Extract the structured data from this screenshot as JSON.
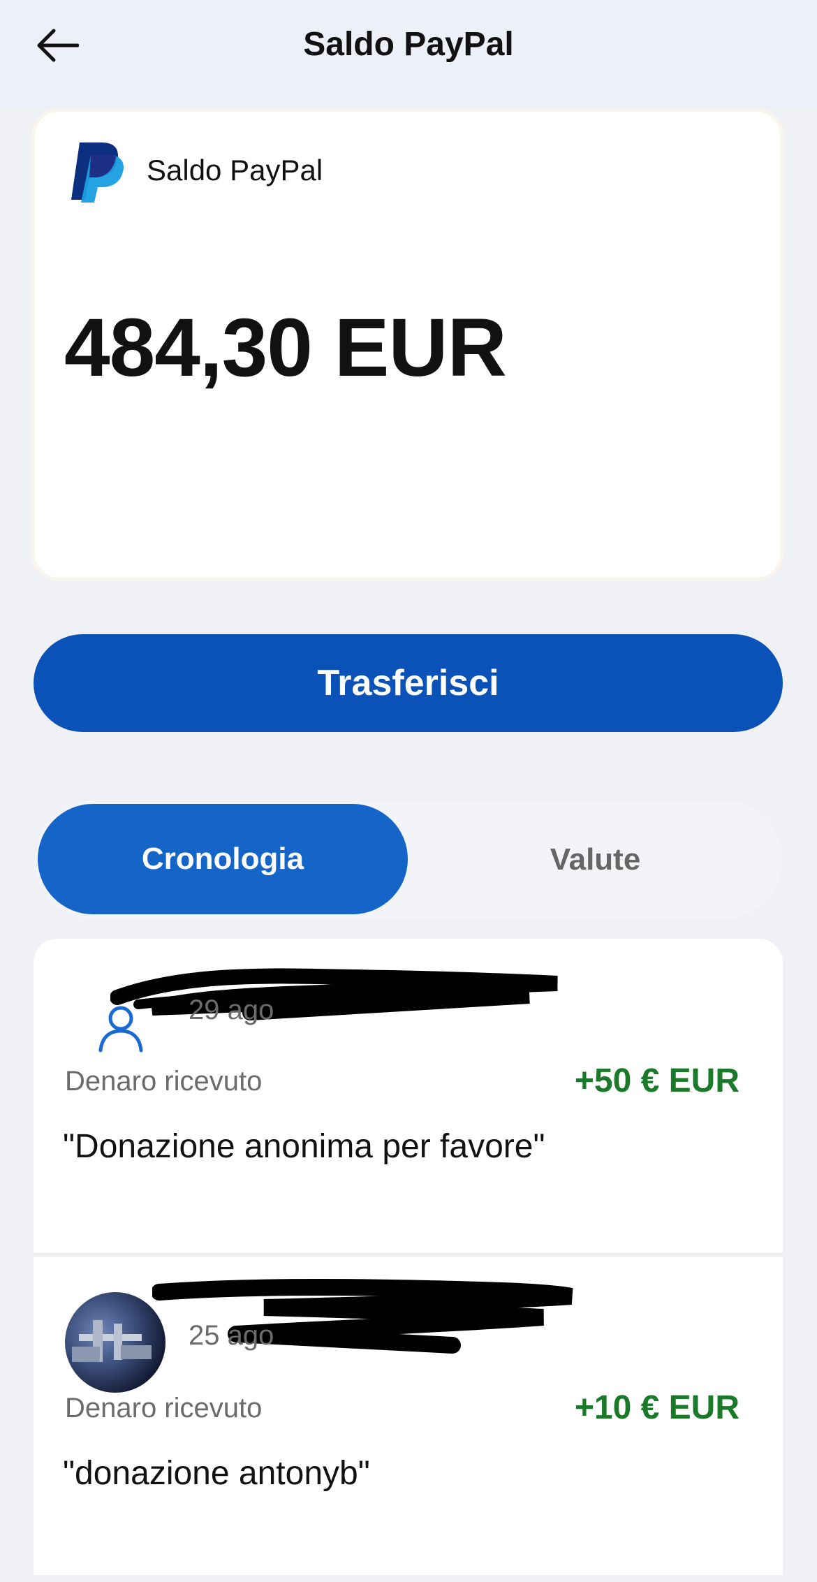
{
  "header": {
    "title": "Saldo PayPal",
    "back_icon": "arrow-left-icon"
  },
  "balance_card": {
    "logo_icon": "paypal-logo-icon",
    "label": "Saldo PayPal",
    "amount": "484,30 EUR"
  },
  "actions": {
    "transfer_label": "Trasferisci"
  },
  "tabs": [
    {
      "label": "Cronologia",
      "active": true
    },
    {
      "label": "Valute",
      "active": false
    }
  ],
  "transactions": [
    {
      "avatar_icon": "person-icon",
      "date": "29 ago",
      "type": "Denaro ricevuto",
      "amount": "+50 € EUR",
      "note": "\"Donazione anonima per favore\""
    },
    {
      "avatar_icon": "profile-photo",
      "date": "25 ago",
      "type": "Denaro ricevuto",
      "amount": "+10 € EUR",
      "note": "\"donazione antonyb\""
    }
  ],
  "colors": {
    "primary_blue": "#0b52b8",
    "tab_blue": "#1565c9",
    "positive_green": "#1b7a29",
    "background": "#eff1f5"
  }
}
